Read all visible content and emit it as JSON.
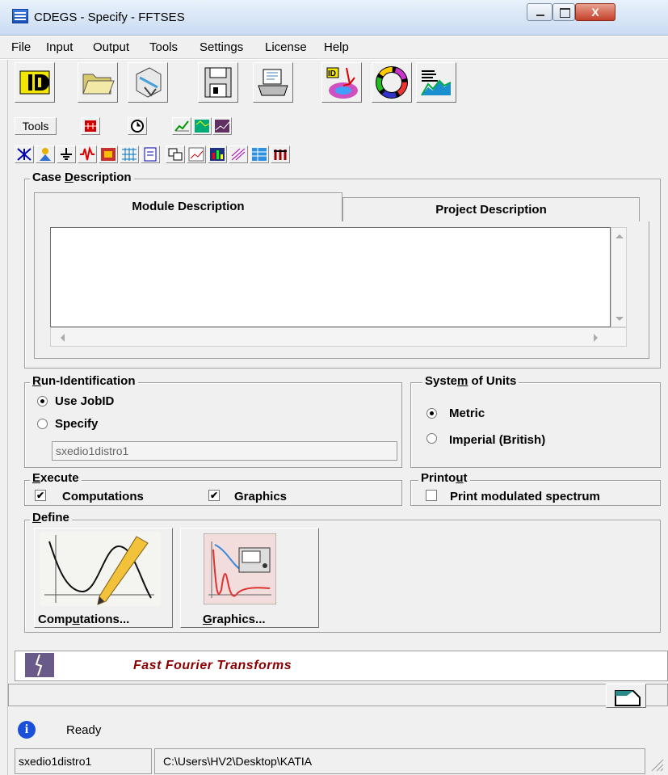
{
  "window": {
    "title": "CDEGS - Specify - FFTSES",
    "close_glyph": "X"
  },
  "menu": [
    "File",
    "Input",
    "Output",
    "Tools",
    "Settings",
    "License",
    "Help"
  ],
  "toolbar": {
    "tools_label": "Tools",
    "big_icons": [
      "id-card-icon",
      "folder-open-icon",
      "import-icon",
      "save-disk-icon",
      "printer-icon",
      "id-plot-icon",
      "cycle-icon",
      "chart-bars-icon"
    ],
    "small_icons": [
      "circuit-icon",
      "clock-icon",
      "graph-icon",
      "map-icon",
      "trend-icon"
    ],
    "row3_icons": [
      "network-icon",
      "person-icon",
      "ground-icon",
      "waveform-icon",
      "grid-image-icon",
      "mesh-icon",
      "document-icon",
      "copy-icon",
      "window-chart-icon",
      "bar-chart-icon",
      "lines-icon",
      "table-icon",
      "stack-icon"
    ]
  },
  "case_description": {
    "label_pre": "Case ",
    "label_key": "D",
    "label_post": "escription",
    "tabs": [
      "Module Description",
      "Project Description"
    ],
    "text": ""
  },
  "run_identification": {
    "label_key": "R",
    "label_post": "un-Identification",
    "options": [
      "Use JobID",
      "Specify"
    ],
    "selected": "Use JobID",
    "job_field": "sxedio1distro1"
  },
  "system_of_units": {
    "label_pre": "Syste",
    "label_key": "m",
    "label_post": " of Units",
    "options": [
      "Metric",
      "Imperial (British)"
    ],
    "selected": "Metric"
  },
  "execute": {
    "label_key": "E",
    "label_post": "xecute",
    "computations": {
      "label": "Computations",
      "checked": true,
      "mark": "✔"
    },
    "graphics": {
      "label": "Graphics",
      "checked": true,
      "mark": "✔"
    }
  },
  "printout": {
    "label_pre": "Printo",
    "label_key": "u",
    "label_post": "t",
    "option": "Print modulated spectrum",
    "checked": false
  },
  "define": {
    "label_key": "D",
    "label_post": "efine",
    "buttons": [
      {
        "pre": "Comp",
        "key": "u",
        "post": "tations...",
        "icon": "computation-chart-icon"
      },
      {
        "pre": "",
        "key": "G",
        "post": "raphics...",
        "icon": "oscilloscope-icon"
      }
    ]
  },
  "banner": {
    "text": "Fast Fourier Transforms",
    "icon": "lightning-icon"
  },
  "status": {
    "message": "Ready",
    "job": "sxedio1distro1",
    "path": "C:\\Users\\HV2\\Desktop\\KATIA"
  },
  "colors": {
    "banner_text": "#8b0000",
    "info_icon": "#1a4fd8",
    "window_bg": "#f0f0f0"
  }
}
